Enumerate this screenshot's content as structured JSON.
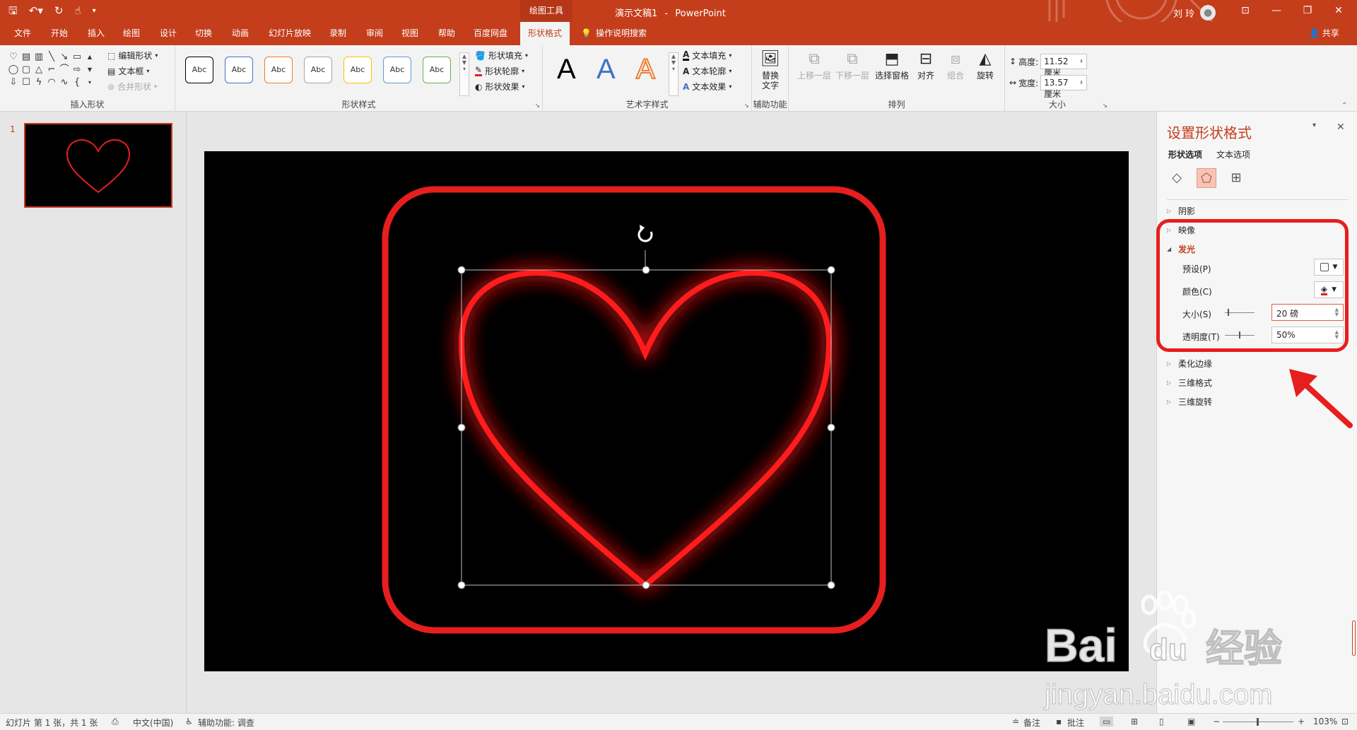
{
  "titlebar": {
    "doc_title": "演示文稿1",
    "separator": "-",
    "app_name": "PowerPoint",
    "context_tab_group": "绘图工具",
    "user_name": "刘 玲"
  },
  "tabs": [
    {
      "label": "文件"
    },
    {
      "label": "开始"
    },
    {
      "label": "插入"
    },
    {
      "label": "绘图"
    },
    {
      "label": "设计"
    },
    {
      "label": "切换"
    },
    {
      "label": "动画"
    },
    {
      "label": "幻灯片放映"
    },
    {
      "label": "录制"
    },
    {
      "label": "审阅"
    },
    {
      "label": "视图"
    },
    {
      "label": "帮助"
    },
    {
      "label": "百度网盘"
    },
    {
      "label": "形状格式",
      "active": true
    }
  ],
  "tell_me": "操作说明搜索",
  "share": "共享",
  "ribbon": {
    "insert_shapes": {
      "edit_shape": "编辑形状",
      "text_box": "文本框",
      "merge_shapes": "合并形状",
      "label": "插入形状"
    },
    "shape_styles": {
      "sample": "Abc",
      "fill": "形状填充",
      "outline": "形状轮廓",
      "effects": "形状效果",
      "label": "形状样式"
    },
    "wordart": {
      "letter": "A",
      "text_fill": "文本填充",
      "text_outline": "文本轮廓",
      "text_effects": "文本效果",
      "label": "艺术字样式"
    },
    "accessibility": {
      "alt_text_line1": "替换",
      "alt_text_line2": "文字",
      "label": "辅助功能"
    },
    "arrange": {
      "bring_forward": "上移一层",
      "send_backward": "下移一层",
      "selection_pane": "选择窗格",
      "align": "对齐",
      "group": "组合",
      "rotate": "旋转",
      "label": "排列"
    },
    "size": {
      "height_label": "高度:",
      "height_value": "11.52 厘米",
      "width_label": "宽度:",
      "width_value": "13.57 厘米",
      "label": "大小"
    }
  },
  "slides_pane": {
    "slide_number": "1"
  },
  "format_pane": {
    "title": "设置形状格式",
    "tab_shape": "形状选项",
    "tab_text": "文本选项",
    "sections": {
      "shadow": "阴影",
      "reflection": "映像",
      "glow": "发光",
      "soft_edges": "柔化边缘",
      "format_3d": "三维格式",
      "rotation_3d": "三维旋转"
    },
    "glow": {
      "preset_label": "预设(P)",
      "color_label": "颜色(C)",
      "size_label": "大小(S)",
      "size_value": "20 磅",
      "transparency_label": "透明度(T)",
      "transparency_value": "50%"
    }
  },
  "statusbar": {
    "slide_info": "幻灯片 第 1 张，共 1 张",
    "language": "中文(中国)",
    "accessibility": "辅助功能: 调查",
    "notes": "备注",
    "comments": "批注",
    "zoom": "103%"
  },
  "colors": {
    "accent": "#c43e1c",
    "glow_red": "#ff1a1a",
    "annotation_red": "#e61e1e"
  }
}
